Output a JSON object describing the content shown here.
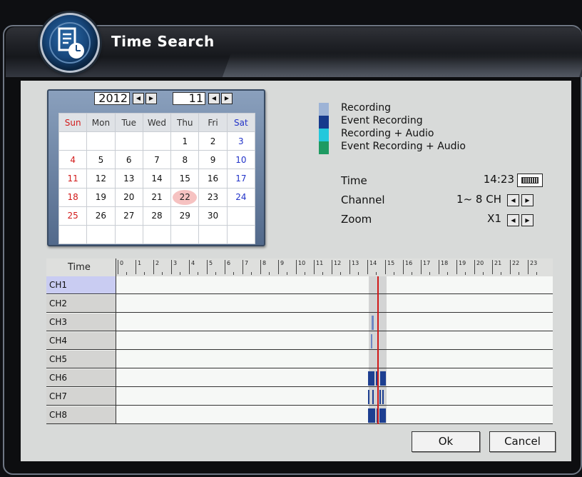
{
  "window": {
    "title": "Time Search"
  },
  "calendar": {
    "year": "2012",
    "month": "11",
    "weekdays": [
      "Sun",
      "Mon",
      "Tue",
      "Wed",
      "Thu",
      "Fri",
      "Sat"
    ],
    "weeks": [
      [
        "",
        "",
        "",
        "",
        "1",
        "2",
        "3"
      ],
      [
        "4",
        "5",
        "6",
        "7",
        "8",
        "9",
        "10"
      ],
      [
        "11",
        "12",
        "13",
        "14",
        "15",
        "16",
        "17"
      ],
      [
        "18",
        "19",
        "20",
        "21",
        "22",
        "23",
        "24"
      ],
      [
        "25",
        "26",
        "27",
        "28",
        "29",
        "30",
        ""
      ],
      [
        "",
        "",
        "",
        "",
        "",
        "",
        ""
      ]
    ],
    "selected_day": "22"
  },
  "legend": [
    {
      "label": "Recording",
      "color": "#9db3d6"
    },
    {
      "label": "Event Recording",
      "color": "#163a8c"
    },
    {
      "label": "Recording + Audio",
      "color": "#22c8dc"
    },
    {
      "label": "Event Recording + Audio",
      "color": "#1e9a62"
    }
  ],
  "info": {
    "time_label": "Time",
    "time_value": "14:23",
    "channel_label": "Channel",
    "channel_value": "1~ 8 CH",
    "zoom_label": "Zoom",
    "zoom_value": "X1"
  },
  "timeline": {
    "header_label": "Time",
    "hours": [
      "0",
      "1",
      "2",
      "3",
      "4",
      "5",
      "6",
      "7",
      "8",
      "9",
      "10",
      "11",
      "12",
      "13",
      "14",
      "15",
      "16",
      "17",
      "18",
      "19",
      "20",
      "21",
      "22",
      "23"
    ],
    "channels": [
      "CH1",
      "CH2",
      "CH3",
      "CH4",
      "CH5",
      "CH6",
      "CH7",
      "CH8"
    ],
    "selected_channel": "CH1"
  },
  "buttons": {
    "ok": "Ok",
    "cancel": "Cancel"
  },
  "icons": {
    "logo": "time-search-icon",
    "keyboard": "keyboard-icon",
    "left": "arrow-left-icon",
    "right": "arrow-right-icon"
  }
}
